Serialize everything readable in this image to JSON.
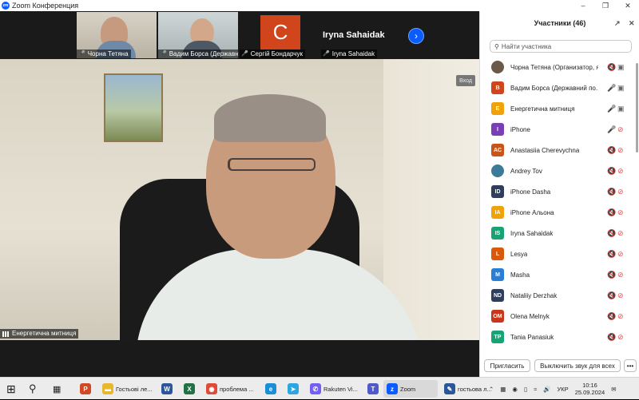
{
  "window": {
    "title": "Zoom Конференция",
    "logo_text": "zm"
  },
  "thumbnails": [
    {
      "name": "Чорна Тетяна"
    },
    {
      "name": "Вадим Борса (Державни..."
    },
    {
      "name": "Сергій Бондарчук",
      "avatar_letter": "С",
      "avatar_color": "#d0451b"
    },
    {
      "name": "Iryna Sahaidak",
      "big_name": "Iryna Sahaidak"
    }
  ],
  "main_video": {
    "exit_label": "Вход",
    "speaker_name": "Енергетична митниця"
  },
  "panel": {
    "title": "Участники (46)",
    "search_placeholder": "Найти участника",
    "participants": [
      {
        "initials": "",
        "name": "Чорна Тетяна (Организатор, я)",
        "color": "#6b5a4a",
        "mic": "off",
        "cam": "on"
      },
      {
        "initials": "В",
        "name": "Вадим Борса (Державний по...",
        "color": "#d0451b",
        "mic": "on",
        "cam": "on"
      },
      {
        "initials": "Е",
        "name": "Енергетична митниця",
        "color": "#f0a20a",
        "mic": "on",
        "cam": "on"
      },
      {
        "initials": "I",
        "name": "iPhone",
        "color": "#7b3fb5",
        "mic": "on",
        "cam": "off"
      },
      {
        "initials": "AC",
        "name": "Anastasiia Cherevychna",
        "color": "#c8541a",
        "mic": "off",
        "cam": "off"
      },
      {
        "initials": "",
        "name": "Andrey Tov",
        "color": "#3c7a9a",
        "mic": "off",
        "cam": "off"
      },
      {
        "initials": "ID",
        "name": "iPhone Dasha",
        "color": "#2e3e5c",
        "mic": "off",
        "cam": "off"
      },
      {
        "initials": "IA",
        "name": "iPhone Альона",
        "color": "#f0a20a",
        "mic": "off",
        "cam": "off"
      },
      {
        "initials": "IS",
        "name": "Iryna Sahaidak",
        "color": "#1aa372",
        "mic": "off",
        "cam": "off"
      },
      {
        "initials": "L",
        "name": "Lesya",
        "color": "#d9590b",
        "mic": "off",
        "cam": "off"
      },
      {
        "initials": "M",
        "name": "Masha",
        "color": "#2a7fd4",
        "mic": "off",
        "cam": "off"
      },
      {
        "initials": "ND",
        "name": "Nataliiy Derzhak",
        "color": "#2e3e5c",
        "mic": "off",
        "cam": "off"
      },
      {
        "initials": "OM",
        "name": "Olena Melnyk",
        "color": "#c8361b",
        "mic": "off",
        "cam": "off"
      },
      {
        "initials": "TP",
        "name": "Tania Panasiuk",
        "color": "#1aa372",
        "mic": "off",
        "cam": "off"
      }
    ],
    "invite_label": "Пригласить",
    "unmute_all_label": "Выключить звук для всех",
    "more_label": "•••"
  },
  "taskbar": {
    "apps": [
      {
        "label": "",
        "icon": "P",
        "color": "#d24726"
      },
      {
        "label": "Гостьові ле...",
        "icon": "▬",
        "color": "#e8b730"
      },
      {
        "label": "",
        "icon": "W",
        "color": "#2b579a"
      },
      {
        "label": "",
        "icon": "X",
        "color": "#1f7244"
      },
      {
        "label": "проблема ...",
        "icon": "◉",
        "color": "#dd4b39"
      },
      {
        "label": "",
        "icon": "e",
        "color": "#1a8fd6"
      },
      {
        "label": "",
        "icon": "➤",
        "color": "#2ca5e0"
      },
      {
        "label": "Rakuten Vi...",
        "icon": "✆",
        "color": "#7360f2"
      },
      {
        "label": "",
        "icon": "T",
        "color": "#5059c9"
      },
      {
        "label": "Zoom",
        "icon": "z",
        "color": "#0b5cff"
      },
      {
        "label": "гостьова л...",
        "icon": "✎",
        "color": "#2b579a"
      }
    ],
    "lang": "УКР",
    "time": "10:16",
    "date": "25.09.2024"
  }
}
